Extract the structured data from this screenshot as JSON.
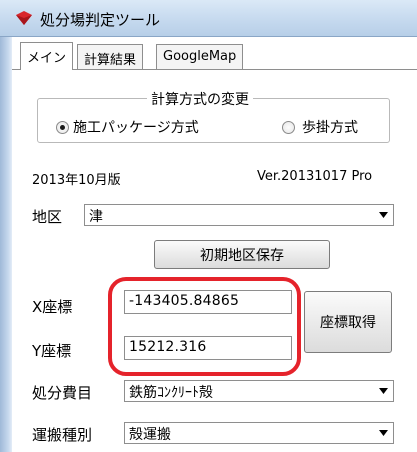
{
  "window": {
    "title": "処分場判定ツール"
  },
  "tabs": [
    {
      "label": "メイン"
    },
    {
      "label": "計算結果"
    },
    {
      "label": "GoogleMap"
    }
  ],
  "calc_method": {
    "legend": "計算方式の変更",
    "options": [
      {
        "label": "施工パッケージ方式",
        "selected": true
      },
      {
        "label": "歩掛方式",
        "selected": false
      }
    ]
  },
  "info": {
    "edition": "2013年10月版",
    "version": "Ver.20131017 Pro"
  },
  "district": {
    "label": "地区",
    "value": "津"
  },
  "save_initial_button": "初期地区保存",
  "coords": {
    "x_label": "X座標",
    "x_value": "-143405.84865",
    "y_label": "Y座標",
    "y_value": "15212.316",
    "get_button": "座標取得"
  },
  "disposal_cost": {
    "label": "処分費目",
    "value": "鉄筋ｺﾝｸﾘｰﾄ殻"
  },
  "transport_type": {
    "label": "運搬種別",
    "value": "殻運搬"
  },
  "colors": {
    "highlight": "#e5232b"
  }
}
